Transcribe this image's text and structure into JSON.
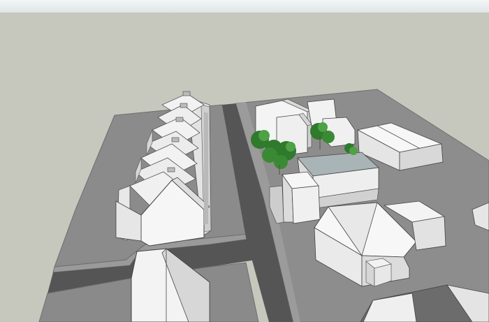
{
  "scene": {
    "description_visible_text": "",
    "colors": {
      "sky_top": "#f2f6f7",
      "sky_bottom": "#dfe6e7",
      "ground": "#c6c8bd",
      "block_surface": "#8a8a8a",
      "block_edge": "#707070",
      "road": "#555555",
      "roof_light": "#f4f4f4",
      "wall_shade": "#d8d8d8",
      "wall_dark": "#bdbdbd",
      "tree_green": "#2f7a2c",
      "tree_light": "#4ea145",
      "glass_roof": "#a9b4b7"
    }
  }
}
